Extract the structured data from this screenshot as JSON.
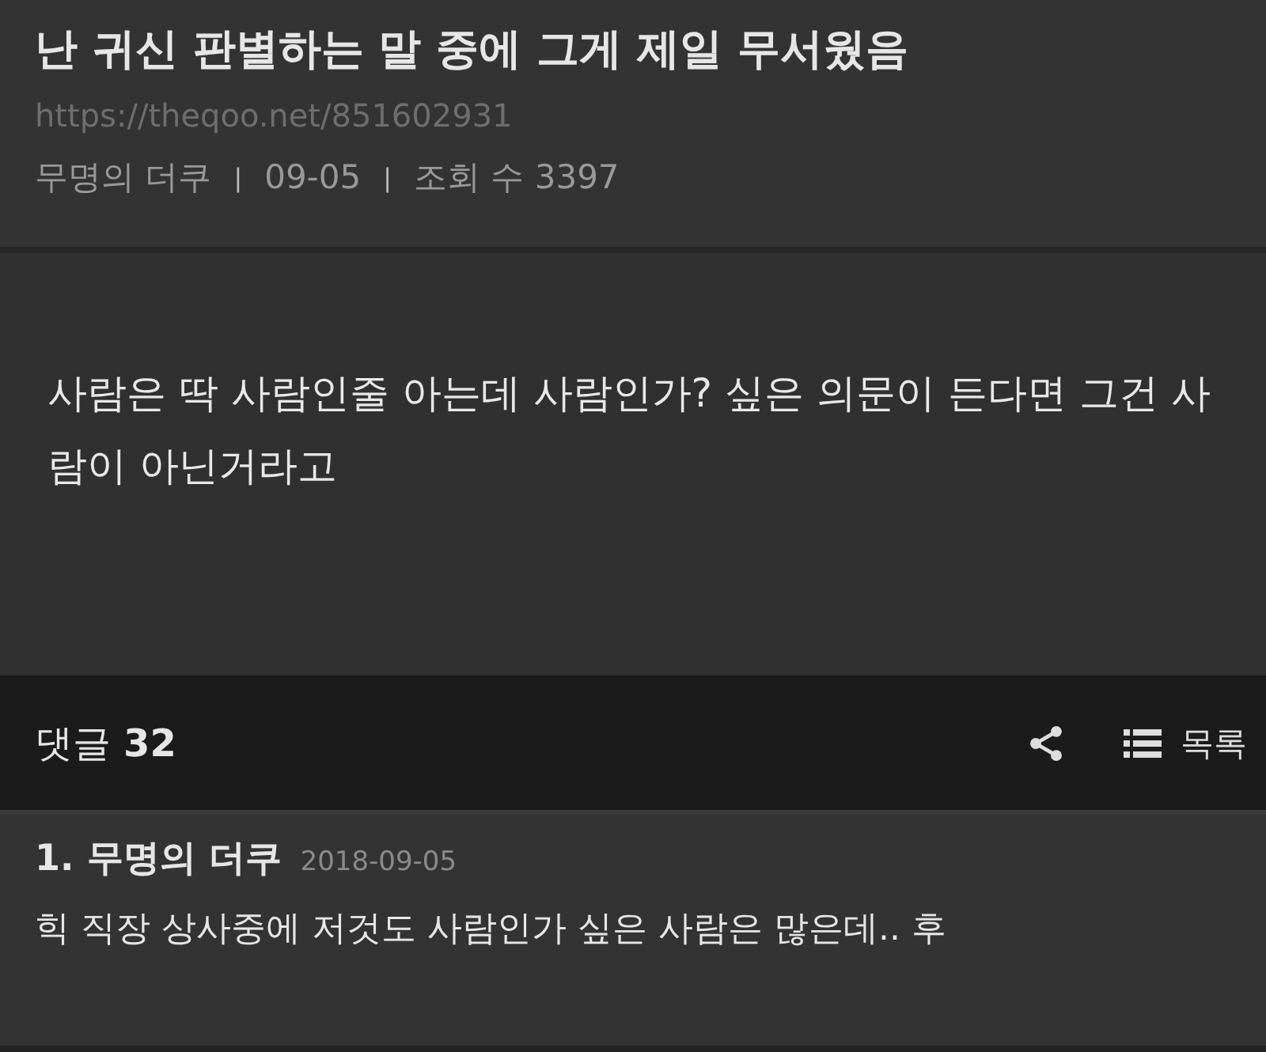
{
  "post": {
    "title": "난 귀신 판별하는 말 중에 그게 제일 무서웠음",
    "url": "https://theqoo.net/851602931",
    "meta": [
      "무명의 더쿠",
      "09-05",
      "조회 수 3397"
    ],
    "separator": "|",
    "body": "사람은 딱 사람인줄 아는데 사람인가? 싶은 의문이 든다면 그건 사람이 아닌거라고"
  },
  "comment_bar": {
    "label": "댓글",
    "count": "32",
    "list_label": "목록"
  },
  "comments": [
    {
      "number": "1.",
      "author": "무명의 더쿠",
      "date": "2018-09-05",
      "text": "힉 직장 상사중에 저것도 사람인가 싶은 사람은 많은데.. 후"
    }
  ]
}
